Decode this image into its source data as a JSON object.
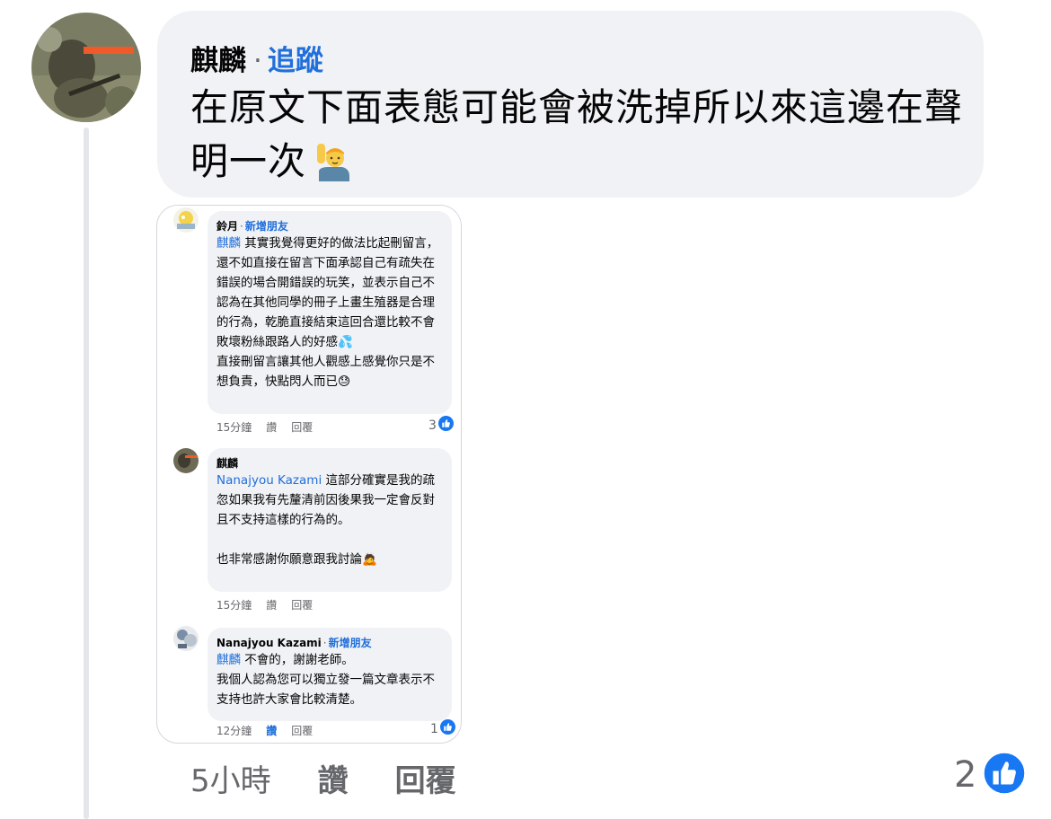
{
  "comment": {
    "author": "麒麟",
    "separator": "·",
    "follow_label": "追蹤",
    "text": "在原文下面表態可能會被洗掉所以來這邊在聲明一次",
    "emoji": "person-raising-hand",
    "time": "5小時",
    "like_label": "讚",
    "reply_label": "回覆",
    "reaction_count": "2"
  },
  "embedded_screenshot": {
    "comments": [
      {
        "author": "鈴月",
        "separator": "·",
        "add_friend": "新增朋友",
        "mention": "麒麟",
        "text": " 其實我覺得更好的做法比起刪留言，還不如直接在留言下面承認自己有疏失在錯誤的場合開錯誤的玩笑，並表示自己不認為在其他同學的冊子上畫生殖器是合理的行為，乾脆直接結束這回合還比較不會敗壞粉絲跟路人的好感💦",
        "text2": "直接刪留言讓其他人觀感上感覺你只是不想負責，快點閃人而已😓",
        "time": "15分鐘",
        "like_label": "讚",
        "reply_label": "回覆",
        "reaction_count": "3"
      },
      {
        "author": "麒麟",
        "mention": "Nanajyou Kazami",
        "text": " 這部分確實是我的疏忽如果我有先釐清前因後果我一定會反對且不支持這樣的行為的。",
        "text2": "也非常感謝你願意跟我討論🙇",
        "time": "15分鐘",
        "like_label": "讚",
        "reply_label": "回覆"
      },
      {
        "author": "Nanajyou Kazami",
        "separator": "·",
        "add_friend": "新增朋友",
        "mention": "麒麟",
        "text": " 不會的，謝謝老師。",
        "text2": "我個人認為您可以獨立發一篇文章表示不支持也許大家會比較清楚。",
        "time": "12分鐘",
        "like_label": "讚",
        "reply_label": "回覆",
        "reaction_count": "1"
      }
    ]
  },
  "colors": {
    "link_blue": "#216fdb",
    "bubble_bg": "#f0f2f5",
    "meta_gray": "#65676b"
  }
}
